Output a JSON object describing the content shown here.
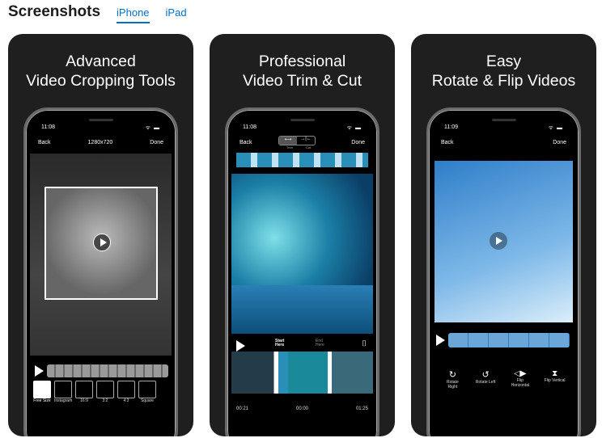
{
  "section": {
    "title": "Screenshots",
    "tabs": [
      {
        "label": "iPhone",
        "active": true
      },
      {
        "label": "iPad",
        "active": false
      }
    ]
  },
  "accent": "#0070c9",
  "cards": [
    {
      "caption1": "Advanced",
      "caption2": "Video Cropping Tools",
      "time": "11:08",
      "back": "Back",
      "title": "1280x720",
      "done": "Done",
      "ratios": [
        "Free Size",
        "Instagram",
        "16:9",
        "3:2",
        "4:3",
        "Square"
      ]
    },
    {
      "caption1": "Professional",
      "caption2": "Video Trim & Cut",
      "time": "11:08",
      "back": "Back",
      "done": "Done",
      "seg_trim": "Trim",
      "seg_cut": "Cut",
      "start": "Start Here",
      "end": "End Here",
      "t_start": "00:21",
      "t_cur": "00:00",
      "t_end": "01:25"
    },
    {
      "caption1": "Easy",
      "caption2": "Rotate & Flip Videos",
      "time": "11:09",
      "back": "Back",
      "done": "Done",
      "actions": [
        "Rotate Right",
        "Rotate Left",
        "Flip Horizontal",
        "Flip Vertical"
      ]
    }
  ]
}
